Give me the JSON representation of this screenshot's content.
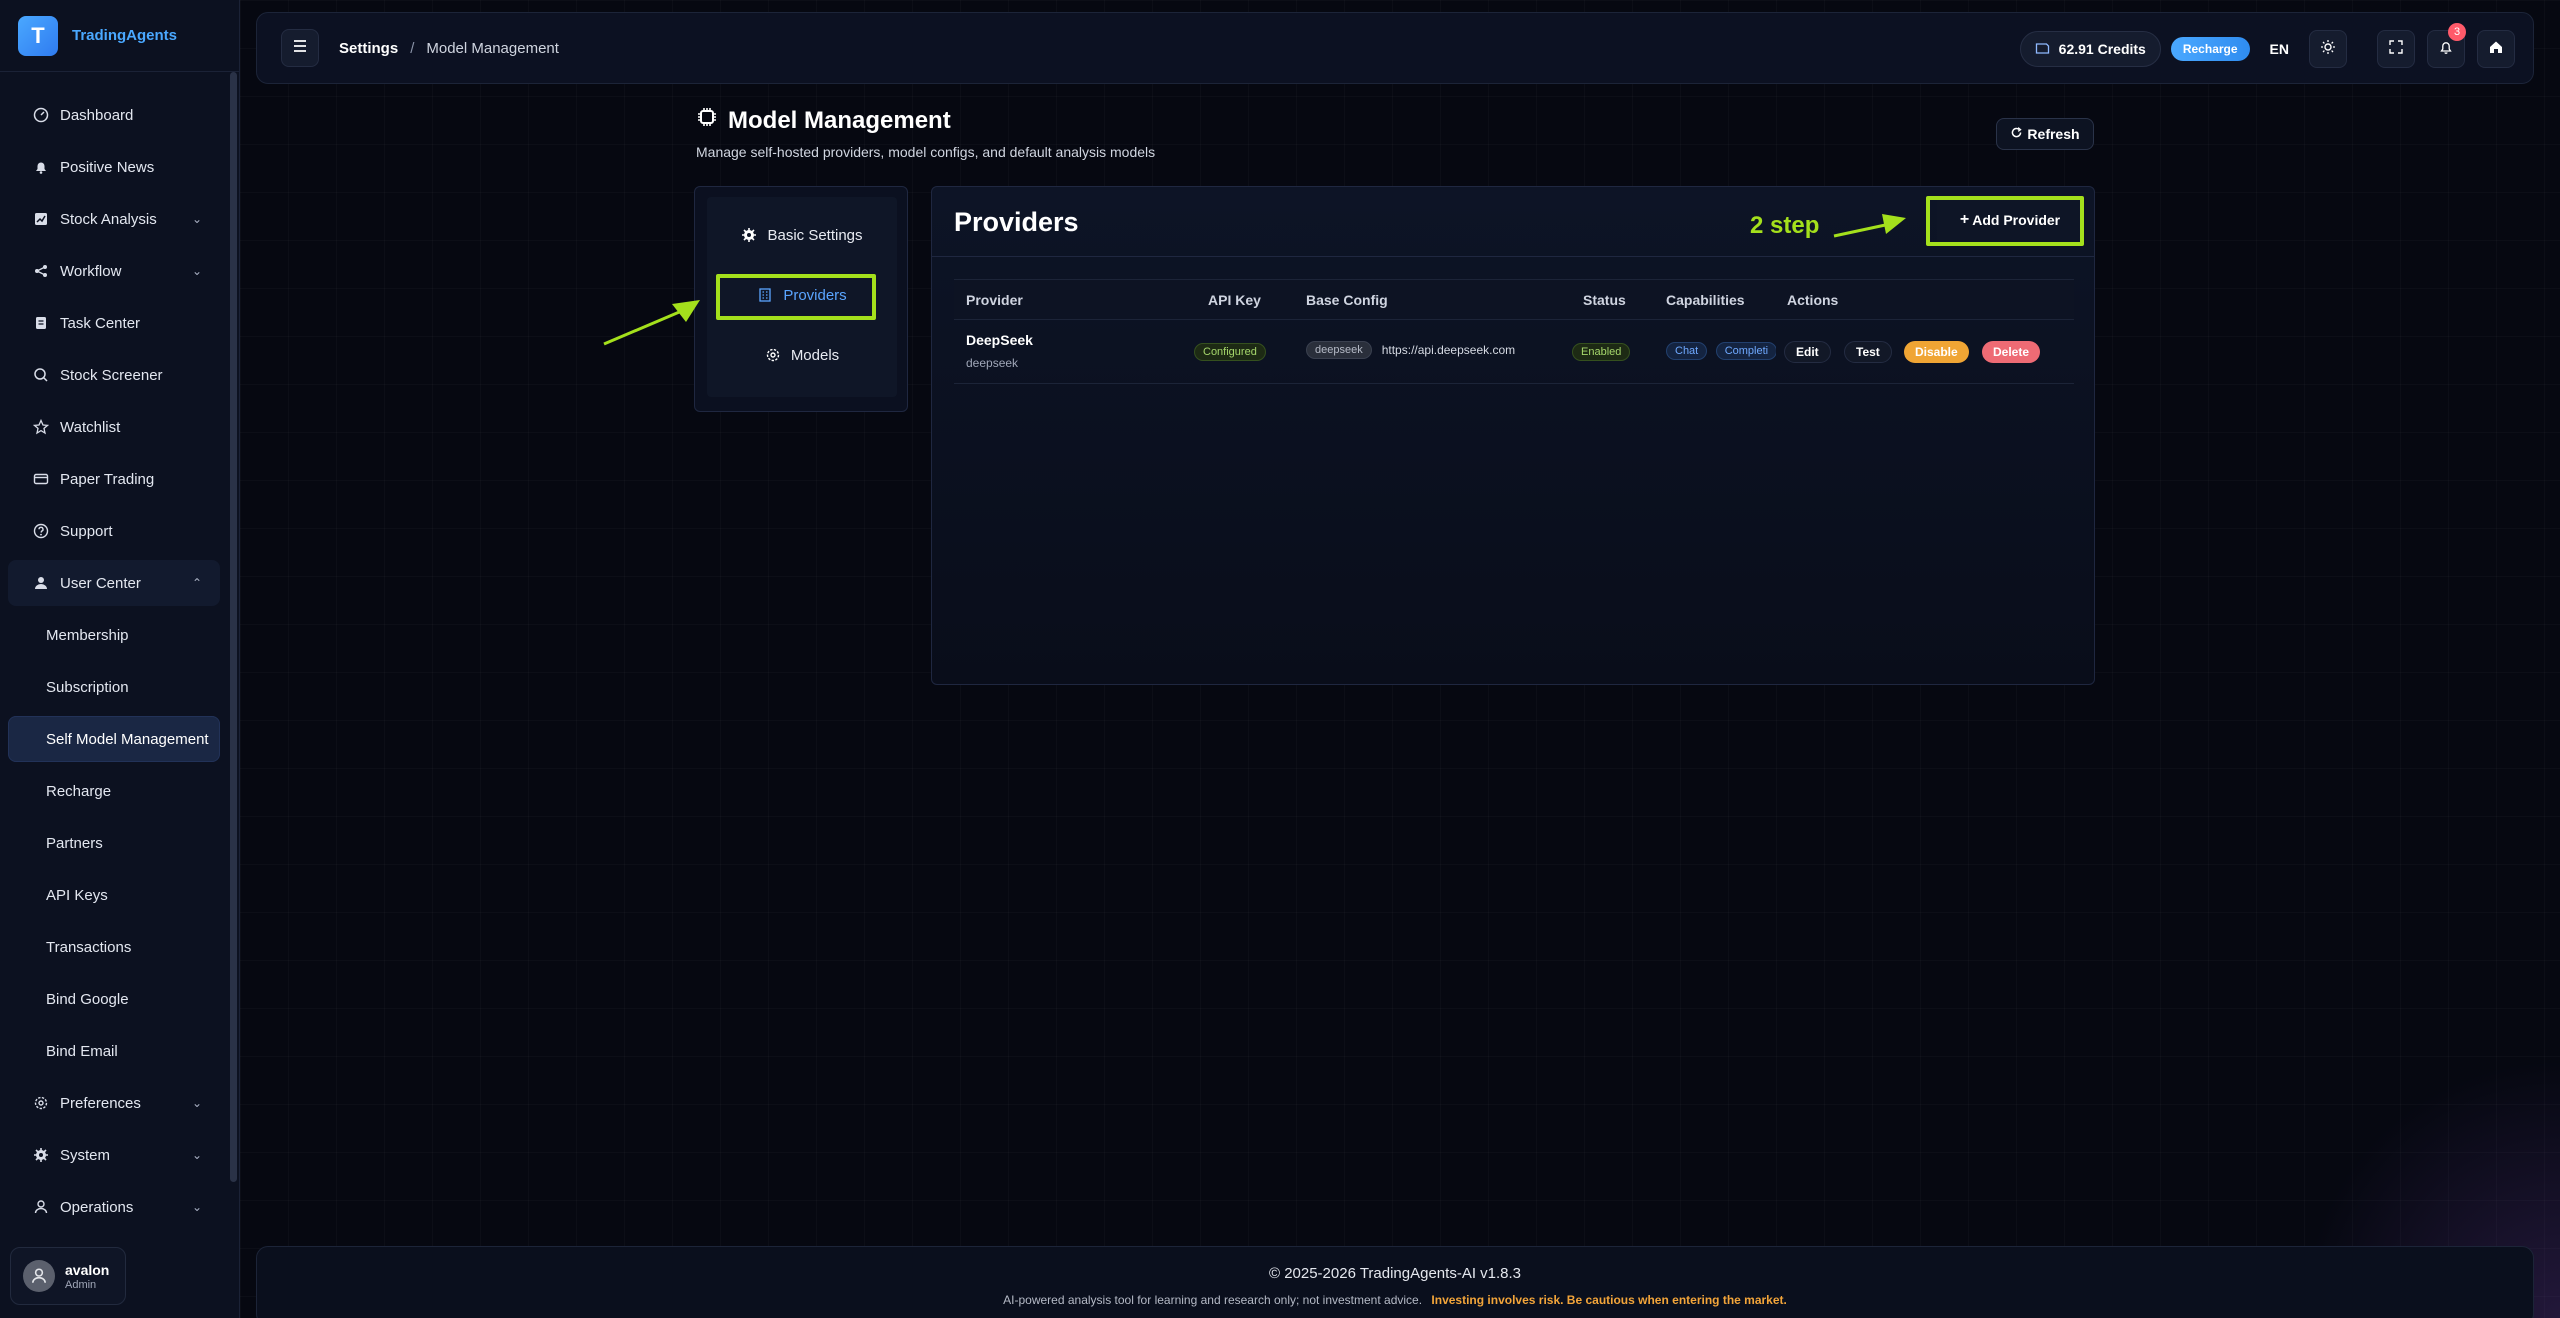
{
  "brand": {
    "logo_letter": "T",
    "name": "TradingAgents"
  },
  "sidebar": {
    "items": [
      {
        "label": "Dashboard",
        "icon": "dashboard-icon"
      },
      {
        "label": "Positive News",
        "icon": "bell-icon"
      },
      {
        "label": "Stock Analysis",
        "icon": "chart-icon",
        "expandable": true
      },
      {
        "label": "Workflow",
        "icon": "share-icon",
        "expandable": true
      },
      {
        "label": "Task Center",
        "icon": "clipboard-icon"
      },
      {
        "label": "Stock Screener",
        "icon": "search-icon"
      },
      {
        "label": "Watchlist",
        "icon": "star-icon"
      },
      {
        "label": "Paper Trading",
        "icon": "card-icon"
      },
      {
        "label": "Support",
        "icon": "help-icon"
      },
      {
        "label": "User Center",
        "icon": "user-icon",
        "expanded": true
      },
      {
        "label": "Membership",
        "sub": true
      },
      {
        "label": "Subscription",
        "sub": true
      },
      {
        "label": "Self Model Management",
        "sub": true,
        "active": true
      },
      {
        "label": "Recharge",
        "sub": true
      },
      {
        "label": "Partners",
        "sub": true
      },
      {
        "label": "API Keys",
        "sub": true
      },
      {
        "label": "Transactions",
        "sub": true
      },
      {
        "label": "Bind Google",
        "sub": true
      },
      {
        "label": "Bind Email",
        "sub": true
      },
      {
        "label": "Preferences",
        "icon": "settings-icon",
        "expandable": true
      },
      {
        "label": "System",
        "icon": "gear-icon",
        "expandable": true
      },
      {
        "label": "Operations",
        "icon": "user-icon",
        "expandable": true
      }
    ]
  },
  "user": {
    "name": "avalon",
    "role": "Admin"
  },
  "header": {
    "crumb_root": "Settings",
    "crumb_sep": "/",
    "crumb_current": "Model Management",
    "credits": "62.91 Credits",
    "recharge": "Recharge",
    "lang": "EN",
    "notif_count": "3"
  },
  "page": {
    "title": "Model Management",
    "subtitle": "Manage self-hosted providers, model configs, and default analysis models",
    "refresh": "Refresh"
  },
  "subnav": {
    "basic": "Basic Settings",
    "providers": "Providers",
    "models": "Models"
  },
  "providers": {
    "title": "Providers",
    "add_label": "Add Provider",
    "step_label": "2 step",
    "columns": [
      "Provider",
      "API Key",
      "Base Config",
      "Status",
      "Capabilities",
      "Actions"
    ],
    "rows": [
      {
        "name": "DeepSeek",
        "code": "deepseek",
        "api_key": "Configured",
        "base_tag": "deepseek",
        "base_url": "https://api.deepseek.com",
        "status": "Enabled",
        "cap1": "Chat",
        "cap2": "Completi",
        "actions": {
          "edit": "Edit",
          "test": "Test",
          "disable": "Disable",
          "delete": "Delete"
        }
      }
    ]
  },
  "footer": {
    "copyright": "© 2025-2026 TradingAgents-AI v1.8.3",
    "disclaimer": "AI-powered analysis tool for learning and research only; not investment advice.",
    "warning": "Investing involves risk. Be cautious when entering the market."
  },
  "colors": {
    "accent": "#4aa8ff",
    "annotation": "#a4e01c",
    "warning": "#f3a53a",
    "danger": "#ee6b74"
  }
}
